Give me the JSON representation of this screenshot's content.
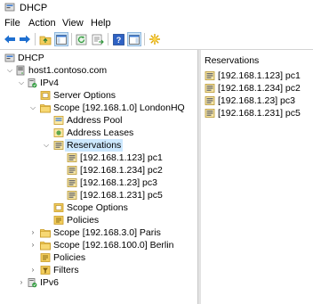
{
  "window": {
    "title": "DHCP"
  },
  "menu": [
    "File",
    "Action",
    "View",
    "Help"
  ],
  "tree": {
    "root": "DHCP",
    "server": "host1.contoso.com",
    "ipv4": "IPv4",
    "server_options": "Server Options",
    "scope_london": "Scope [192.168.1.0] LondonHQ",
    "address_pool": "Address Pool",
    "address_leases": "Address Leases",
    "reservations": "Reservations",
    "res_items": [
      "[192.168.1.123] pc1",
      "[192.168.1.234] pc2",
      "[192.168.1.23] pc3",
      "[192.168.1.231] pc5"
    ],
    "scope_options": "Scope Options",
    "policies_scope": "Policies",
    "scope_paris": "Scope [192.168.3.0] Paris",
    "scope_berlin": "Scope [192.168.100.0] Berlin",
    "policies": "Policies",
    "filters": "Filters",
    "ipv6": "IPv6"
  },
  "details": {
    "header": "Reservations",
    "items": [
      "[192.168.1.123] pc1",
      "[192.168.1.234] pc2",
      "[192.168.1.23] pc3",
      "[192.168.1.231] pc5"
    ]
  },
  "colors": {
    "selection": "#cce8ff",
    "folder": "#e8c14e",
    "arrow_blue": "#1e6fd0"
  }
}
